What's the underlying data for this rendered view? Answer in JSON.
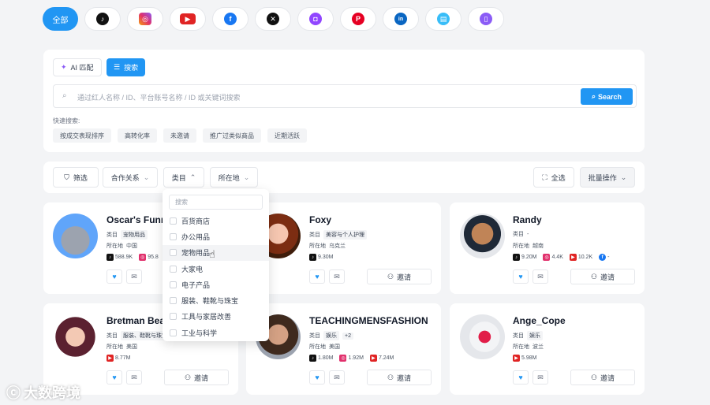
{
  "platform_bar": {
    "all_label": "全部",
    "platforms": [
      {
        "name": "tiktok",
        "glyph": "♪",
        "color": "#111111"
      },
      {
        "name": "instagram",
        "glyph": "◎",
        "color": "#e1306c"
      },
      {
        "name": "youtube",
        "glyph": "▶",
        "color": "#e02424"
      },
      {
        "name": "facebook",
        "glyph": "f",
        "color": "#1877f2"
      },
      {
        "name": "x",
        "glyph": "✕",
        "color": "#111111"
      },
      {
        "name": "twitch",
        "glyph": "◘",
        "color": "#9146ff"
      },
      {
        "name": "pinterest",
        "glyph": "P",
        "color": "#e60023"
      },
      {
        "name": "linkedin",
        "glyph": "in",
        "color": "#0a66c2"
      },
      {
        "name": "message",
        "glyph": "▤",
        "color": "#38bdf8"
      },
      {
        "name": "phone",
        "glyph": "▯",
        "color": "#8b5cf6"
      }
    ]
  },
  "search_panel": {
    "ai_match_label": "AI 匹配",
    "search_tab_label": "搜索",
    "placeholder": "通过红人名称 / ID、平台账号名称 / ID 或关键词搜索",
    "search_button": "Search",
    "quick_label": "快速搜索:",
    "quick_chips": [
      "按成交表现排序",
      "高转化率",
      "未邀请",
      "推广过类似商品",
      "近期活跃"
    ]
  },
  "filter_bar": {
    "filter": "筛选",
    "cooperation": "合作关系",
    "category": "类目",
    "location": "所在地",
    "select_all": "全选",
    "batch": "批量操作"
  },
  "dropdown": {
    "search_placeholder": "搜索",
    "items": [
      "百货商店",
      "办公用品",
      "宠物用品",
      "大家电",
      "电子产品",
      "服装、鞋靴与珠宝",
      "工具与家居改善",
      "工业与科学"
    ],
    "hover_index": 2
  },
  "labels": {
    "category": "类目",
    "location": "所在地",
    "invite": "邀请"
  },
  "cards": [
    {
      "name": "Oscar's Funny",
      "category": "宠物用品",
      "location": "中国",
      "stats": [
        {
          "p": "tiktok",
          "v": "588.9K"
        },
        {
          "p": "instagram",
          "v": "95.8"
        }
      ]
    },
    {
      "name": "Foxy",
      "category": "美容与个人护理",
      "location": "乌克兰",
      "stats": [
        {
          "p": "tiktok",
          "v": "9.30M"
        }
      ]
    },
    {
      "name": "Randy",
      "category": "-",
      "location": "越南",
      "stats": [
        {
          "p": "tiktok",
          "v": "9.20M"
        },
        {
          "p": "instagram",
          "v": "4.4K"
        },
        {
          "p": "youtube",
          "v": "10.2K"
        },
        {
          "p": "facebook",
          "v": "-"
        }
      ]
    },
    {
      "name": "Bretman Beau",
      "category": "服装、鞋靴与珠宝",
      "location": "美国",
      "stats": [
        {
          "p": "youtube",
          "v": "8.77M"
        }
      ]
    },
    {
      "name": "TEACHINGMENSFASHION",
      "category": "娱乐",
      "extra": "+2",
      "location": "美国",
      "stats": [
        {
          "p": "tiktok",
          "v": "1.80M"
        },
        {
          "p": "instagram",
          "v": "1.92M"
        },
        {
          "p": "youtube",
          "v": "7.24M"
        }
      ]
    },
    {
      "name": "Ange_Cope",
      "category": "娱乐",
      "location": "波兰",
      "stats": [
        {
          "p": "youtube",
          "v": "5.98M"
        }
      ]
    }
  ],
  "watermark": "大数跨境"
}
